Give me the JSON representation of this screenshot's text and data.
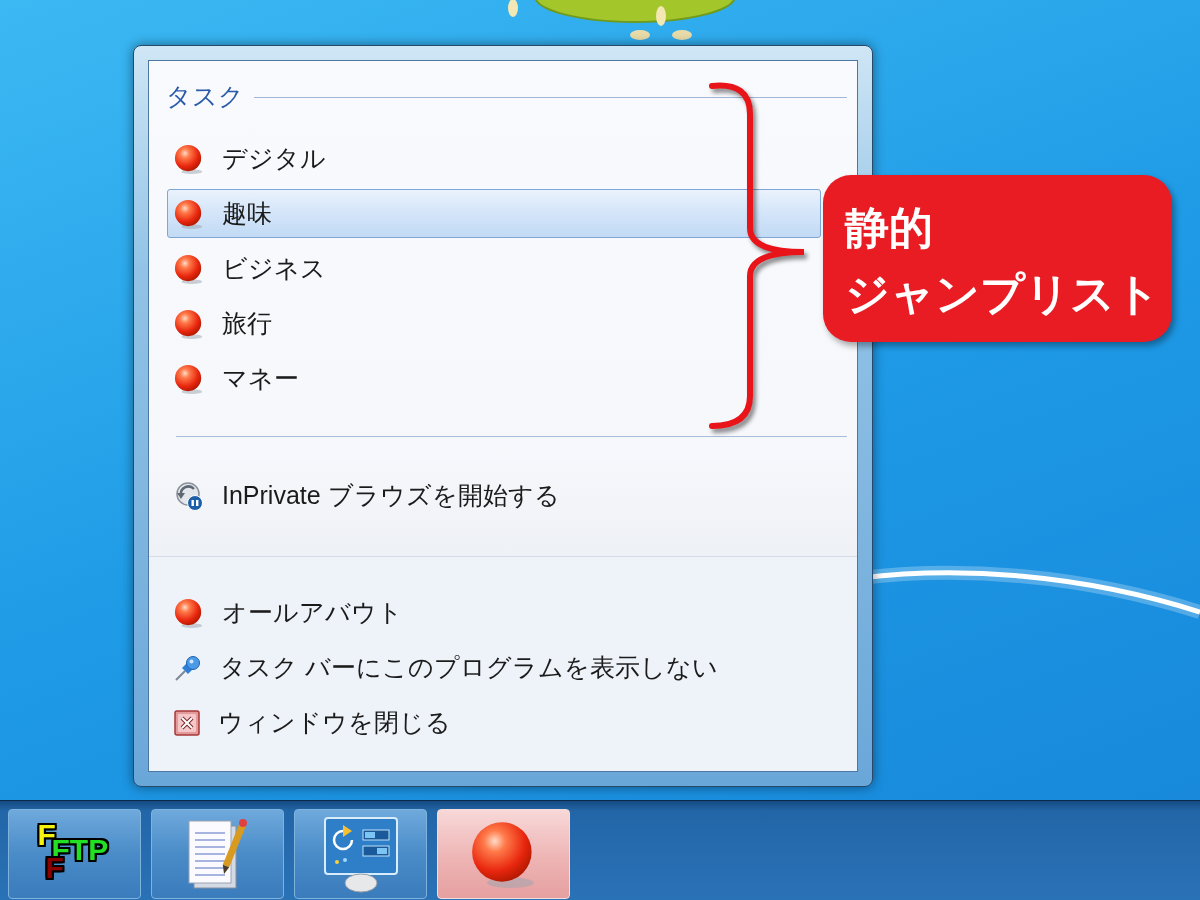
{
  "jump_list": {
    "heading": "タスク",
    "tasks": [
      {
        "label": "デジタル",
        "selected": false
      },
      {
        "label": "趣味",
        "selected": true
      },
      {
        "label": "ビジネス",
        "selected": false
      },
      {
        "label": "旅行",
        "selected": false
      },
      {
        "label": "マネー",
        "selected": false
      }
    ],
    "inprivate": {
      "label": "InPrivate ブラウズを開始する",
      "selected": false
    },
    "actions": [
      {
        "kind": "app",
        "label": "オールアバウト",
        "selected": false
      },
      {
        "kind": "unpin",
        "label": "タスク バーにこのプログラムを表示しない",
        "selected": false
      },
      {
        "kind": "close",
        "label": "ウィンドウを閉じる",
        "selected": false
      }
    ]
  },
  "annotation": {
    "lines": [
      "静的",
      "ジャンプリスト"
    ]
  },
  "taskbar": {
    "buttons": [
      {
        "kind": "ftp",
        "logo": [
          "F",
          "FTP",
          "F"
        ],
        "selected": false
      },
      {
        "kind": "notepad",
        "selected": false
      },
      {
        "kind": "control-panel",
        "selected": false
      },
      {
        "kind": "app",
        "selected": true
      }
    ]
  }
}
